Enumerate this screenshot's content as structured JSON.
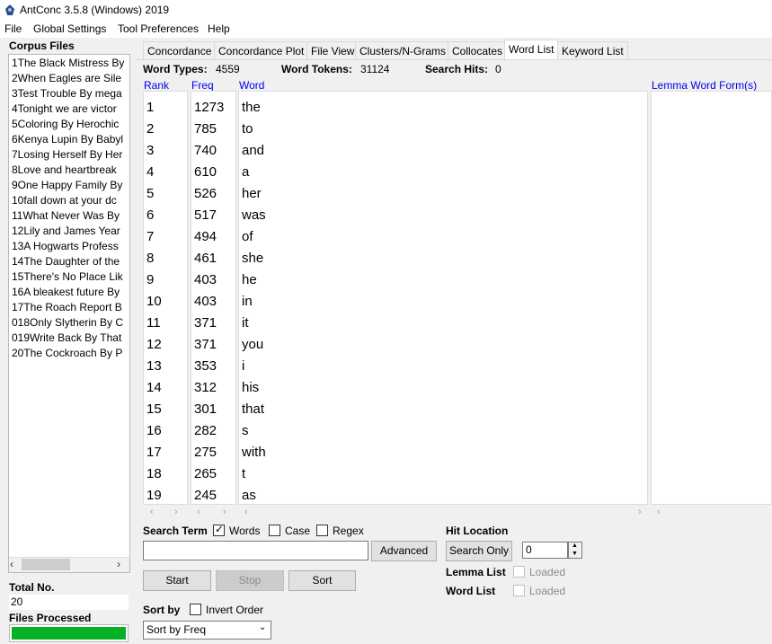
{
  "window": {
    "title": "AntConc 3.5.8 (Windows) 2019"
  },
  "menu": [
    "File",
    "Global Settings",
    "Tool Preferences",
    "Help"
  ],
  "corpus": {
    "label": "Corpus Files",
    "files": [
      "1The Black Mistress By",
      "2When Eagles are Sile",
      "3Test Trouble By mega",
      "4Tonight we are victor",
      "5Coloring By Herochic",
      "6Kenya Lupin By Babyl",
      "7Losing Herself By Her",
      "8Love and heartbreak",
      "9One Happy Family By",
      "10fall down at your dc",
      "11What Never Was By",
      "12Lily and James Year",
      "13A Hogwarts Profess",
      "14The Daughter of the",
      "15There's No Place Lik",
      "16A bleakest future By",
      "17The Roach Report B",
      "018Only Slytherin By C",
      "019Write Back By That",
      "20The Cockroach By P"
    ],
    "total_label": "Total No.",
    "total_value": "20",
    "files_processed_label": "Files Processed",
    "progress_fraction": 1.0
  },
  "tabs": [
    "Concordance",
    "Concordance Plot",
    "File View",
    "Clusters/N-Grams",
    "Collocates",
    "Word List",
    "Keyword List"
  ],
  "active_tab": "Word List",
  "stats": {
    "word_types_label": "Word Types:",
    "word_types_value": "4559",
    "word_tokens_label": "Word Tokens:",
    "word_tokens_value": "31124",
    "search_hits_label": "Search Hits:",
    "search_hits_value": "0"
  },
  "columns": {
    "rank": "Rank",
    "freq": "Freq",
    "word": "Word",
    "lemma": "Lemma Word Form(s)"
  },
  "rows": [
    {
      "rank": "1",
      "freq": "1273",
      "word": "the"
    },
    {
      "rank": "2",
      "freq": "785",
      "word": "to"
    },
    {
      "rank": "3",
      "freq": "740",
      "word": "and"
    },
    {
      "rank": "4",
      "freq": "610",
      "word": "a"
    },
    {
      "rank": "5",
      "freq": "526",
      "word": "her"
    },
    {
      "rank": "6",
      "freq": "517",
      "word": "was"
    },
    {
      "rank": "7",
      "freq": "494",
      "word": "of"
    },
    {
      "rank": "8",
      "freq": "461",
      "word": "she"
    },
    {
      "rank": "9",
      "freq": "403",
      "word": "he"
    },
    {
      "rank": "10",
      "freq": "403",
      "word": "in"
    },
    {
      "rank": "11",
      "freq": "371",
      "word": "it"
    },
    {
      "rank": "12",
      "freq": "371",
      "word": "you"
    },
    {
      "rank": "13",
      "freq": "353",
      "word": "i"
    },
    {
      "rank": "14",
      "freq": "312",
      "word": "his"
    },
    {
      "rank": "15",
      "freq": "301",
      "word": "that"
    },
    {
      "rank": "16",
      "freq": "282",
      "word": "s"
    },
    {
      "rank": "17",
      "freq": "275",
      "word": "with"
    },
    {
      "rank": "18",
      "freq": "265",
      "word": "t"
    },
    {
      "rank": "19",
      "freq": "245",
      "word": "as"
    }
  ],
  "search": {
    "label": "Search Term",
    "words_label": "Words",
    "words_checked": true,
    "case_label": "Case",
    "case_checked": false,
    "regex_label": "Regex",
    "regex_checked": false,
    "input_value": "",
    "advanced_label": "Advanced",
    "start_label": "Start",
    "stop_label": "Stop",
    "sort_label": "Sort"
  },
  "hit_location": {
    "label": "Hit Location",
    "search_only_label": "Search Only",
    "spin_value": "0",
    "lemma_list_label": "Lemma List",
    "word_list_label": "Word List",
    "loaded_label": "Loaded"
  },
  "sort": {
    "label": "Sort by",
    "invert_label": "Invert Order",
    "invert_checked": false,
    "selected": "Sort by Freq"
  },
  "colors": {
    "progress": "#06b025",
    "column_header": "#0000ee"
  }
}
